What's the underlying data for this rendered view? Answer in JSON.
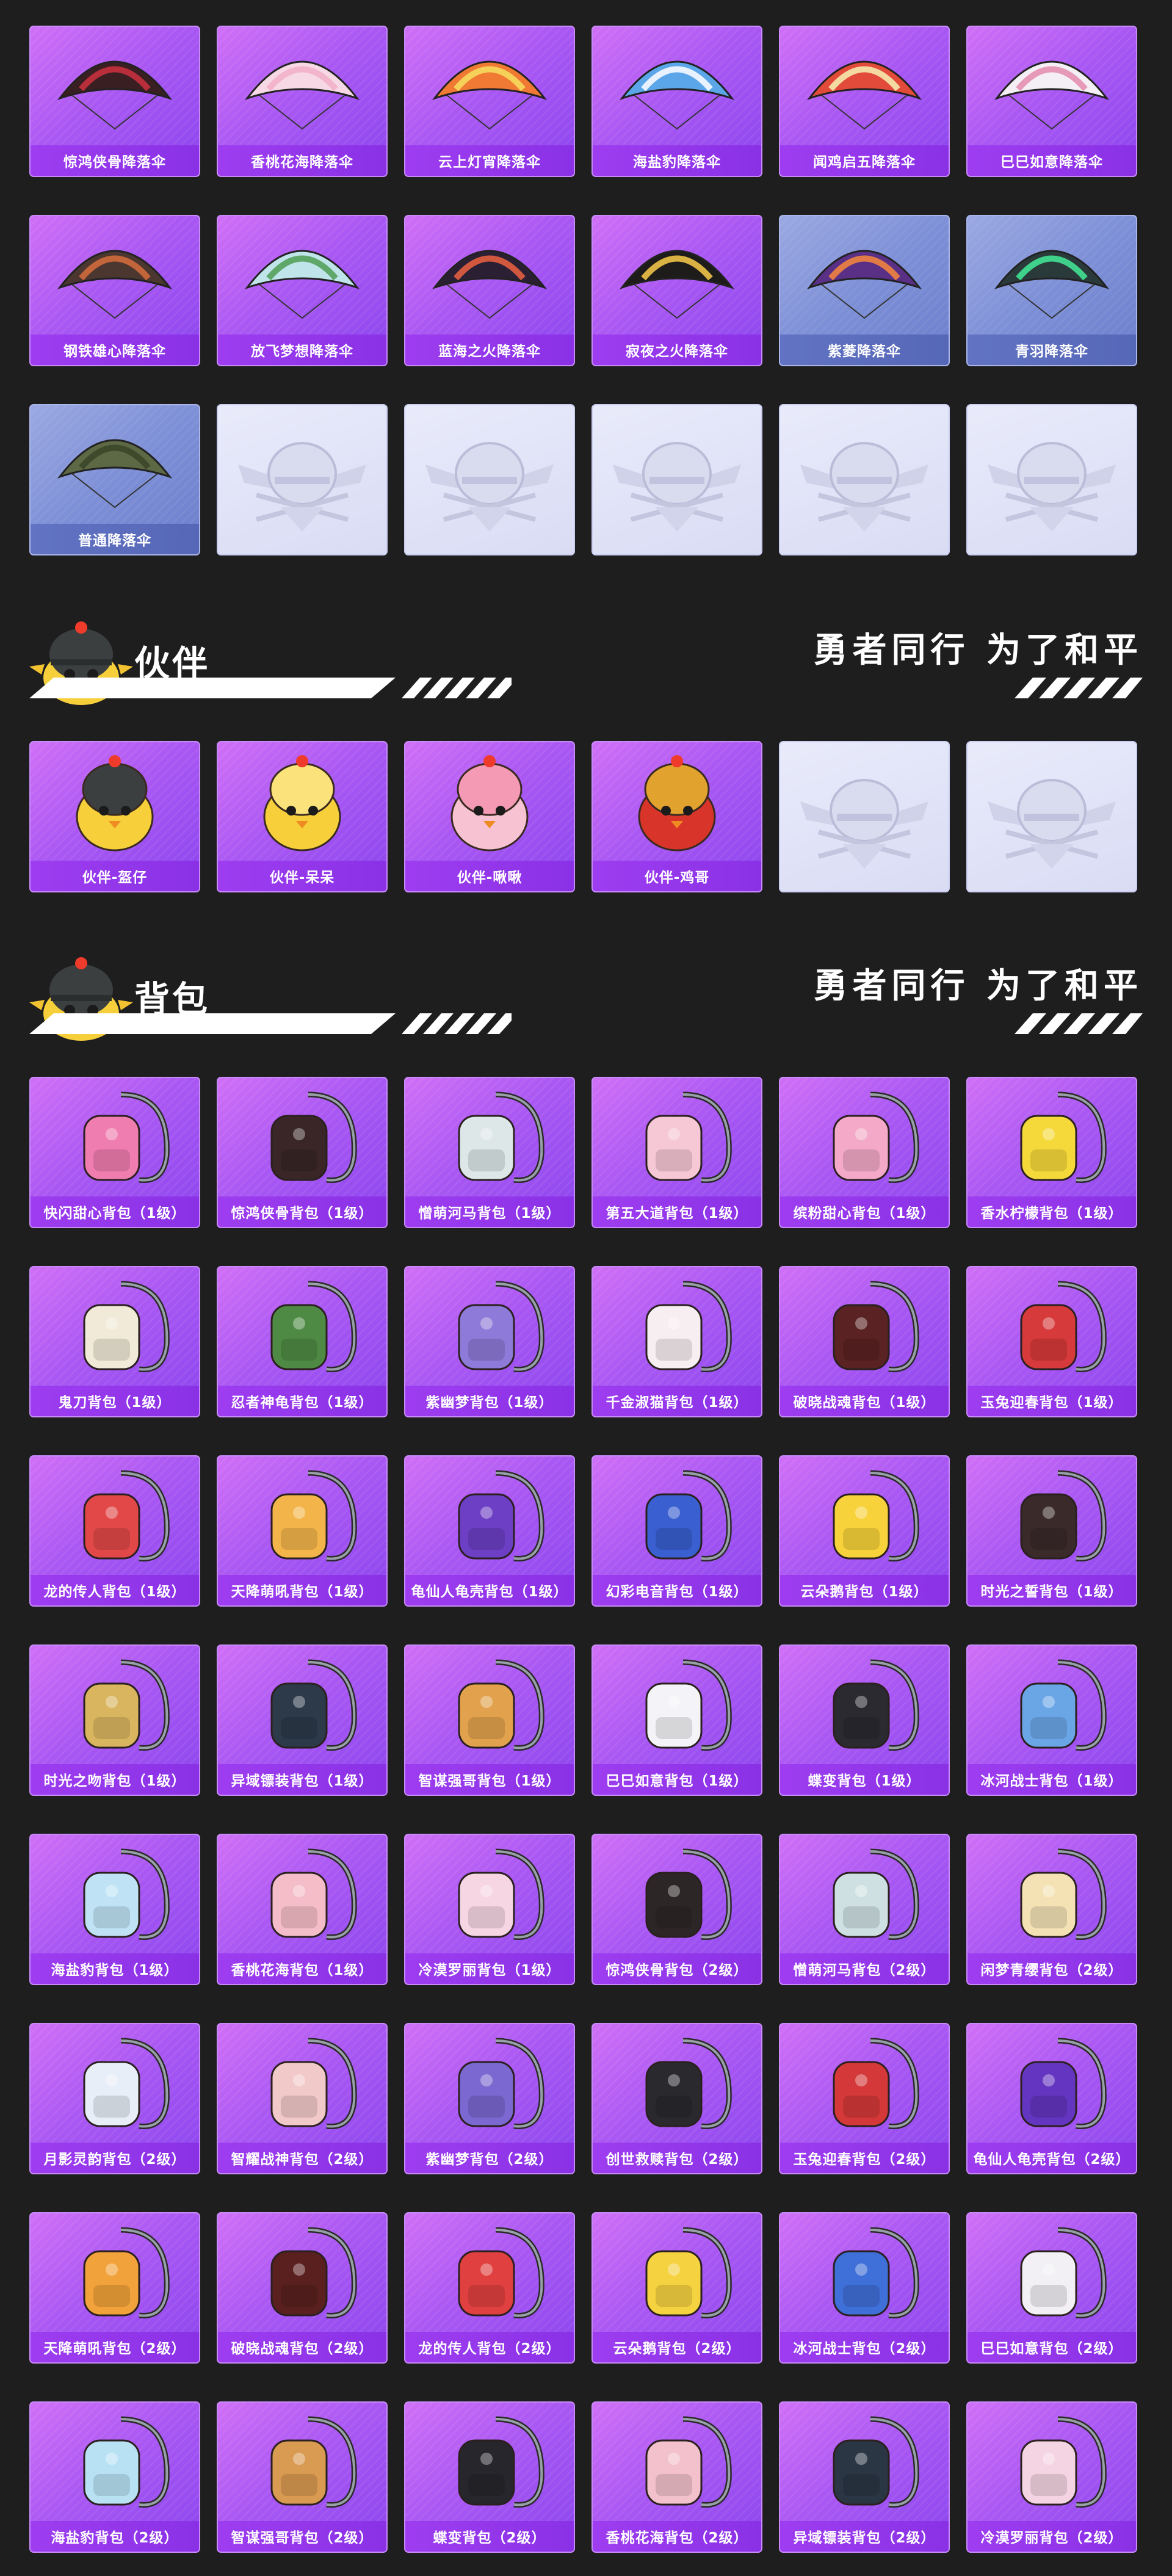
{
  "parachutes": [
    {
      "label": "惊鸿侠骨降落伞",
      "style": "purple",
      "art": "chute-dark-red"
    },
    {
      "label": "香桃花海降落伞",
      "style": "purple",
      "art": "chute-pink"
    },
    {
      "label": "云上灯宵降落伞",
      "style": "purple",
      "art": "chute-orange"
    },
    {
      "label": "海盐豹降落伞",
      "style": "purple",
      "art": "chute-blue-panda"
    },
    {
      "label": "闻鸡启五降落伞",
      "style": "purple",
      "art": "chute-red-rooster"
    },
    {
      "label": "巳巳如意降落伞",
      "style": "purple",
      "art": "chute-white-snake"
    },
    {
      "label": "钢铁雄心降落伞",
      "style": "purple",
      "art": "chute-plaid"
    },
    {
      "label": "放飞梦想降落伞",
      "style": "purple",
      "art": "chute-green-balloon"
    },
    {
      "label": "蓝海之火降落伞",
      "style": "purple",
      "art": "chute-dark-stripe"
    },
    {
      "label": "寂夜之火降落伞",
      "style": "purple",
      "art": "chute-black-gold"
    },
    {
      "label": "紫菱降落伞",
      "style": "blue",
      "art": "chute-purple-plaid"
    },
    {
      "label": "青羽降落伞",
      "style": "blue",
      "art": "chute-green-plaid"
    },
    {
      "label": "普通降落伞",
      "style": "blue",
      "art": "chute-olive"
    },
    {
      "label": "",
      "style": "empty",
      "art": "placeholder-emblem"
    },
    {
      "label": "",
      "style": "empty",
      "art": "placeholder-emblem"
    },
    {
      "label": "",
      "style": "empty",
      "art": "placeholder-emblem"
    },
    {
      "label": "",
      "style": "empty",
      "art": "placeholder-emblem"
    },
    {
      "label": "",
      "style": "empty",
      "art": "placeholder-emblem"
    }
  ],
  "companion_section": {
    "title": "伙伴",
    "slogan": "勇者同行 为了和平",
    "mascot": "chick-helmet-mascot"
  },
  "companions": [
    {
      "label": "伙伴-盔仔",
      "style": "purple",
      "art": "chick-helmet"
    },
    {
      "label": "伙伴-呆呆",
      "style": "purple",
      "art": "chick-yellow"
    },
    {
      "label": "伙伴-啾啾",
      "style": "purple",
      "art": "bird-pink"
    },
    {
      "label": "伙伴-鸡哥",
      "style": "purple",
      "art": "rooster-sunglasses"
    },
    {
      "label": "",
      "style": "empty",
      "art": "placeholder-emblem"
    },
    {
      "label": "",
      "style": "empty",
      "art": "placeholder-emblem"
    }
  ],
  "backpack_section": {
    "title": "背包",
    "slogan": "勇者同行 为了和平",
    "mascot": "chick-helmet-mascot"
  },
  "backpacks": [
    {
      "label": "快闪甜心背包（1级）",
      "color": "#f07db0"
    },
    {
      "label": "惊鸿侠骨背包（1级）",
      "color": "#3a2626"
    },
    {
      "label": "憎萌河马背包（1级）",
      "color": "#dde7e8"
    },
    {
      "label": "第五大道背包（1级）",
      "color": "#f6c7d4"
    },
    {
      "label": "缤粉甜心背包（1级）",
      "color": "#f3a9c7"
    },
    {
      "label": "香水柠檬背包（1级）",
      "color": "#f5d93b"
    },
    {
      "label": "鬼刀背包（1级）",
      "color": "#f1ead8"
    },
    {
      "label": "忍者神龟背包（1级）",
      "color": "#4f8a45"
    },
    {
      "label": "紫幽梦背包（1级）",
      "color": "#8e7ad8"
    },
    {
      "label": "千金淑猫背包（1级）",
      "color": "#f7eef2"
    },
    {
      "label": "破晓战魂背包（1级）",
      "color": "#5a2222"
    },
    {
      "label": "玉兔迎春背包（1级）",
      "color": "#d63a3a"
    },
    {
      "label": "龙的传人背包（1级）",
      "color": "#e24848"
    },
    {
      "label": "天降萌吼背包（1级）",
      "color": "#f3b54a"
    },
    {
      "label": "龟仙人龟壳背包（1级）",
      "color": "#6d3fc4"
    },
    {
      "label": "幻彩电音背包（1级）",
      "color": "#3a5fd0"
    },
    {
      "label": "云朵鹅背包（1级）",
      "color": "#f7d23a"
    },
    {
      "label": "时光之誓背包（1级）",
      "color": "#3a2a2a"
    },
    {
      "label": "时光之吻背包（1级）",
      "color": "#d9b560"
    },
    {
      "label": "异域镖装背包（1级）",
      "color": "#2d3a4a"
    },
    {
      "label": "智谋强哥背包（1级）",
      "color": "#e2a24d"
    },
    {
      "label": "巳巳如意背包（1级）",
      "color": "#f4f4f8"
    },
    {
      "label": "蝶变背包（1级）",
      "color": "#2a2a30"
    },
    {
      "label": "冰河战士背包（1级）",
      "color": "#6aa6e6"
    },
    {
      "label": "海盐豹背包（1级）",
      "color": "#bfe3f5"
    },
    {
      "label": "香桃花海背包（1级）",
      "color": "#f5bdc8"
    },
    {
      "label": "冷漠罗丽背包（1级）",
      "color": "#f6d6e3"
    },
    {
      "label": "惊鸿侠骨背包（2级）",
      "color": "#2d2626"
    },
    {
      "label": "憎萌河马背包（2级）",
      "color": "#cfe0e2"
    },
    {
      "label": "闲梦青缨背包（2级）",
      "color": "#f4e2b5"
    },
    {
      "label": "月影灵韵背包（2级）",
      "color": "#e8eef8"
    },
    {
      "label": "智耀战神背包（2级）",
      "color": "#f2c9c9"
    },
    {
      "label": "紫幽梦背包（2级）",
      "color": "#7b68d0"
    },
    {
      "label": "创世救赎背包（2级）",
      "color": "#2a2a2e"
    },
    {
      "label": "玉兔迎春背包（2级）",
      "color": "#d43838"
    },
    {
      "label": "龟仙人龟壳背包（2级）",
      "color": "#6435c0"
    },
    {
      "label": "天降萌吼背包（2级）",
      "color": "#f2a23a"
    },
    {
      "label": "破晓战魂背包（2级）",
      "color": "#5a2020"
    },
    {
      "label": "龙的传人背包（2级）",
      "color": "#e04040"
    },
    {
      "label": "云朵鹅背包（2级）",
      "color": "#f5d240"
    },
    {
      "label": "冰河战士背包（2级）",
      "color": "#3f6fd8"
    },
    {
      "label": "巳巳如意背包（2级）",
      "color": "#f2f0f4"
    },
    {
      "label": "海盐豹背包（2级）",
      "color": "#b8e2f4"
    },
    {
      "label": "智谋强哥背包（2级）",
      "color": "#d99a52"
    },
    {
      "label": "蝶变背包（2级）",
      "color": "#26262c"
    },
    {
      "label": "香桃花海背包（2级）",
      "color": "#f3c1cb"
    },
    {
      "label": "异域镖装背包（2级）",
      "color": "#2b3644"
    },
    {
      "label": "冷漠罗丽背包（2级）",
      "color": "#f4d4e2"
    }
  ]
}
